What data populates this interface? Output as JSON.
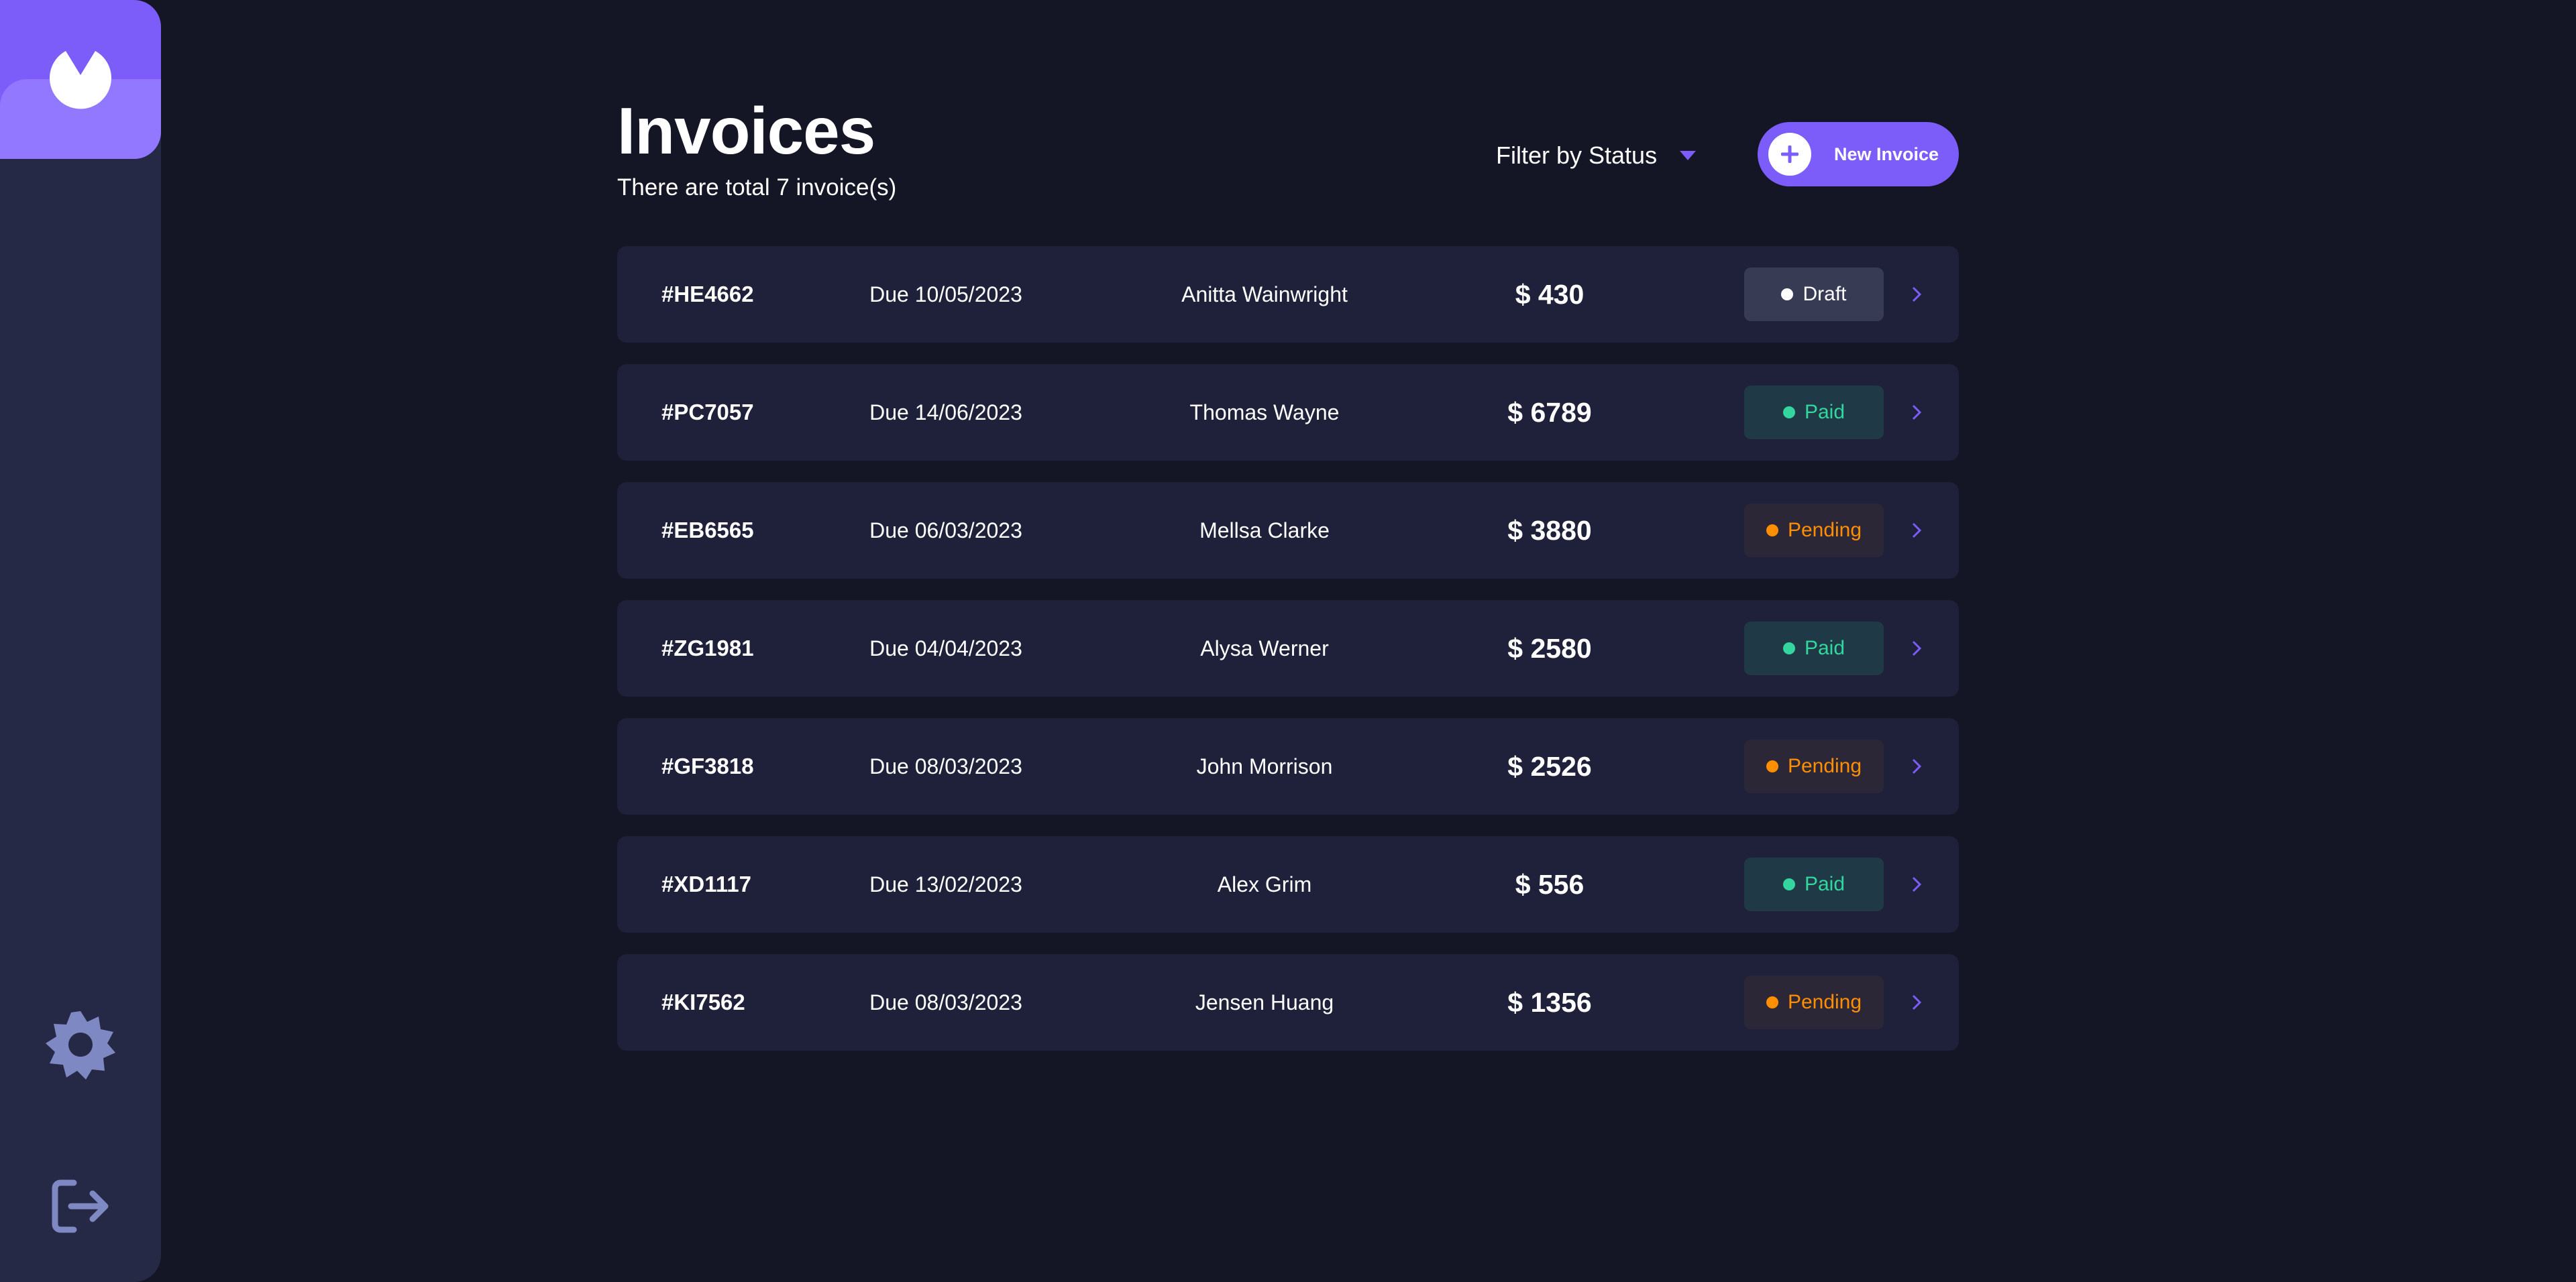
{
  "colors": {
    "accent": "#7C5DFA",
    "accent_light": "#9277FF",
    "background": "#141625",
    "sidebar": "#252945",
    "card": "#1F213A",
    "paid": "#33D69F",
    "pending": "#FF8F00",
    "draft": "#FFFFFF"
  },
  "sidebar": {
    "logo_icon": "app-logo-icon",
    "settings_icon": "settings-gear-icon",
    "logout_icon": "logout-icon"
  },
  "header": {
    "title": "Invoices",
    "subtitle": "There are total 7 invoice(s)",
    "filter_label": "Filter by Status",
    "new_invoice_label": "New Invoice"
  },
  "invoices": [
    {
      "id": "#HE4662",
      "due": "Due 10/05/2023",
      "client": "Anitta Wainwright",
      "amount": "$ 430",
      "status": "Draft",
      "status_key": "draft"
    },
    {
      "id": "#PC7057",
      "due": "Due 14/06/2023",
      "client": "Thomas Wayne",
      "amount": "$ 6789",
      "status": "Paid",
      "status_key": "paid"
    },
    {
      "id": "#EB6565",
      "due": "Due 06/03/2023",
      "client": "Mellsa Clarke",
      "amount": "$ 3880",
      "status": "Pending",
      "status_key": "pending"
    },
    {
      "id": "#ZG1981",
      "due": "Due 04/04/2023",
      "client": "Alysa Werner",
      "amount": "$ 2580",
      "status": "Paid",
      "status_key": "paid"
    },
    {
      "id": "#GF3818",
      "due": "Due 08/03/2023",
      "client": "John Morrison",
      "amount": "$ 2526",
      "status": "Pending",
      "status_key": "pending"
    },
    {
      "id": "#XD1117",
      "due": "Due 13/02/2023",
      "client": "Alex Grim",
      "amount": "$ 556",
      "status": "Paid",
      "status_key": "paid"
    },
    {
      "id": "#KI7562",
      "due": "Due 08/03/2023",
      "client": "Jensen Huang",
      "amount": "$ 1356",
      "status": "Pending",
      "status_key": "pending"
    }
  ]
}
